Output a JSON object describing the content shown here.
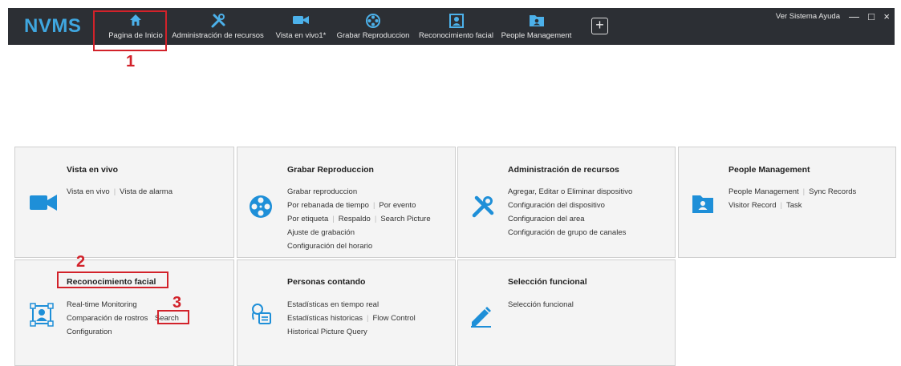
{
  "app": {
    "brand": "NVMS",
    "accent_color": "#3fa7e0",
    "annotation_color": "#d2222a"
  },
  "nav": {
    "items": [
      {
        "label": "Pagina de Inicio",
        "icon": "home-icon"
      },
      {
        "label": "Administración de recursos",
        "icon": "tools-icon"
      },
      {
        "label": "Vista en vivo1*",
        "icon": "video-camera-icon"
      },
      {
        "label": "Grabar Reproduccion",
        "icon": "film-reel-icon"
      },
      {
        "label": "Reconocimiento facial",
        "icon": "face-frame-icon"
      },
      {
        "label": "People Management",
        "icon": "person-folder-icon"
      }
    ],
    "add_button": "+"
  },
  "system": {
    "menu": "Ver Sistema Ayuda",
    "minimize": "—",
    "maximize": "□",
    "close": "×"
  },
  "annotations": [
    "1",
    "2",
    "3"
  ],
  "cards": {
    "vista": {
      "title": "Vista en vivo",
      "icon": "video-camera-icon",
      "lines": [
        [
          "Vista en vivo",
          "Vista de alarma"
        ]
      ]
    },
    "grabar": {
      "title": "Grabar Reproduccion",
      "icon": "film-reel-icon",
      "lines": [
        [
          "Grabar reproduccion"
        ],
        [
          "Por rebanada de tiempo",
          "Por evento"
        ],
        [
          "Por etiqueta",
          "Respaldo",
          "Search Picture"
        ],
        [
          "Ajuste de grabación"
        ],
        [
          "Configuración del horario"
        ]
      ]
    },
    "admin": {
      "title": "Administración de recursos",
      "icon": "tools-icon",
      "lines": [
        [
          "Agregar, Editar o Eliminar dispositivo"
        ],
        [
          "Configuración del dispositivo"
        ],
        [
          "Configuracion del area"
        ],
        [
          "Configuración de grupo de canales"
        ]
      ]
    },
    "people": {
      "title": "People Management",
      "icon": "person-folder-icon",
      "lines": [
        [
          "People Management",
          "Sync Records"
        ],
        [
          "Visitor Record",
          "Task"
        ]
      ]
    },
    "recon": {
      "title": "Reconocimiento facial",
      "icon": "face-frame-icon",
      "lines": [
        [
          "Real-time Monitoring"
        ],
        [
          "Comparación de rostros",
          "Search"
        ],
        [
          "Configuration"
        ]
      ]
    },
    "personas": {
      "title": "Personas contando",
      "icon": "people-counting-icon",
      "lines": [
        [
          "Estadísticas en tiempo real"
        ],
        [
          "Estadísticas historicas",
          "Flow Control"
        ],
        [
          "Historical Picture Query"
        ]
      ]
    },
    "seleccion": {
      "title": "Selección funcional",
      "icon": "pen-edit-icon",
      "lines": [
        [
          "Selección funcional"
        ]
      ]
    }
  }
}
